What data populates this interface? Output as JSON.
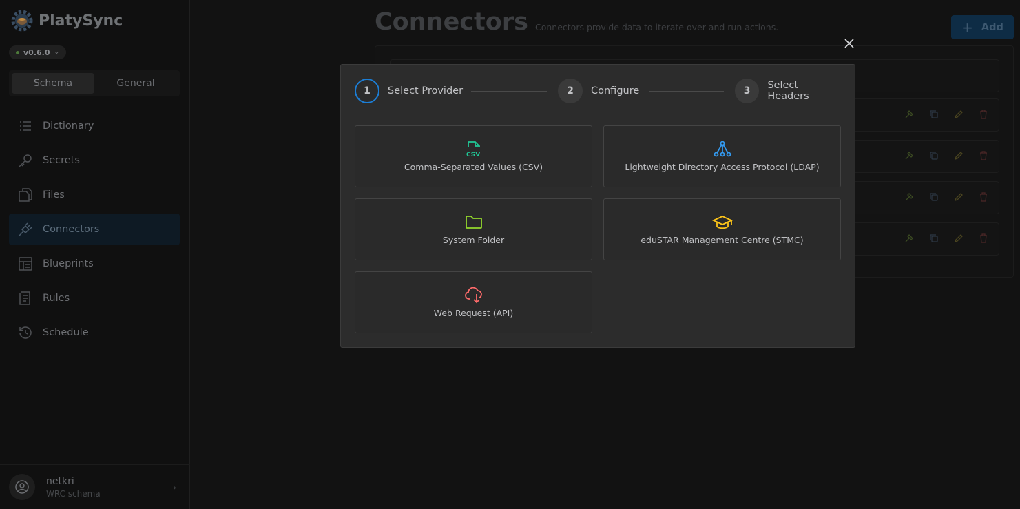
{
  "app": {
    "name": "PlatySync",
    "version": "v0.6.0"
  },
  "sidebar": {
    "tabs": [
      {
        "label": "Schema"
      },
      {
        "label": "General"
      }
    ],
    "items": [
      {
        "label": "Dictionary",
        "icon": "list-icon"
      },
      {
        "label": "Secrets",
        "icon": "key-icon"
      },
      {
        "label": "Files",
        "icon": "files-icon"
      },
      {
        "label": "Connectors",
        "icon": "plug-icon"
      },
      {
        "label": "Blueprints",
        "icon": "blueprint-icon"
      },
      {
        "label": "Rules",
        "icon": "clipboard-icon"
      },
      {
        "label": "Schedule",
        "icon": "history-icon"
      }
    ],
    "user": {
      "name": "netkri",
      "schema": "WRC schema"
    }
  },
  "main": {
    "title": "Connectors",
    "subtitle": "Connectors provide data to iterate over and run actions.",
    "add_label": "Add"
  },
  "modal": {
    "steps": [
      {
        "number": "1",
        "label": "Select Provider"
      },
      {
        "number": "2",
        "label": "Configure"
      },
      {
        "number": "3",
        "label": "Select Headers"
      }
    ],
    "providers": [
      {
        "label": "Comma-Separated Values (CSV)",
        "icon": "csv-file-icon",
        "color": "#20c997"
      },
      {
        "label": "Lightweight Directory Access Protocol (LDAP)",
        "icon": "network-icon",
        "color": "#339af0"
      },
      {
        "label": "System Folder",
        "icon": "folder-icon",
        "color": "#94d82d"
      },
      {
        "label": "eduSTAR Management Centre (STMC)",
        "icon": "graduation-cap-icon",
        "color": "#fcc419"
      },
      {
        "label": "Web Request (API)",
        "icon": "cloud-download-icon",
        "color": "#ff6b6b"
      }
    ]
  },
  "colors": {
    "accent": "#1c7ed6",
    "modal_bg": "#2c2c2c"
  }
}
